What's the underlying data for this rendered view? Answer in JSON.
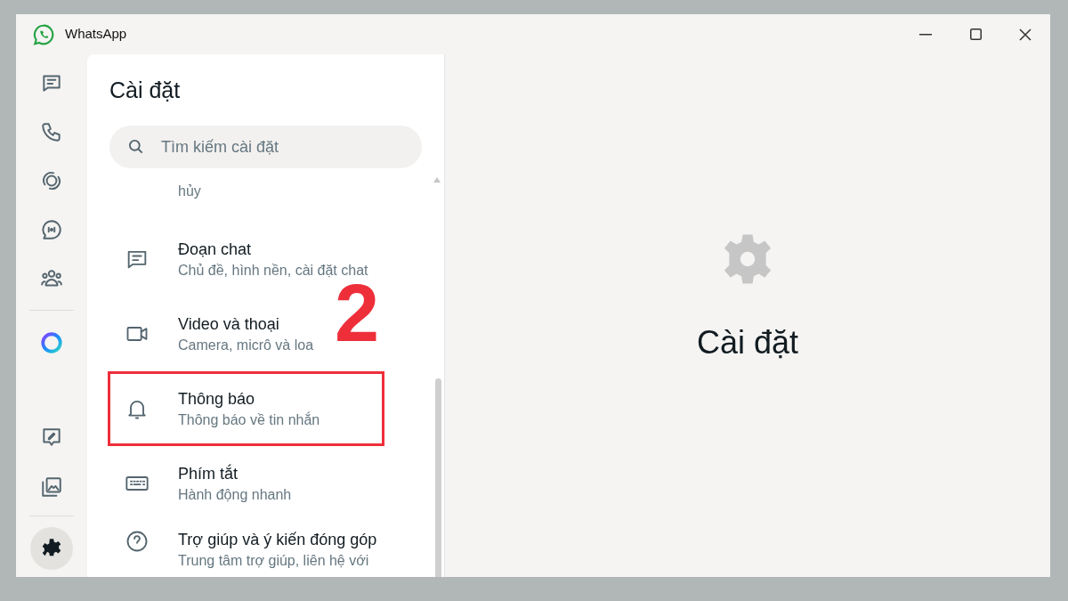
{
  "window": {
    "title": "WhatsApp"
  },
  "nav": {
    "top": [
      {
        "kind": "chats",
        "selected": false
      },
      {
        "kind": "calls",
        "selected": false
      },
      {
        "kind": "status",
        "selected": false
      },
      {
        "kind": "channels",
        "selected": false
      },
      {
        "kind": "communities",
        "selected": false
      }
    ],
    "ai": {
      "kind": "ai"
    },
    "bottom": [
      {
        "kind": "starred",
        "selected": false
      },
      {
        "kind": "media",
        "selected": false
      },
      {
        "kind": "settings",
        "selected": true
      }
    ]
  },
  "settings": {
    "title": "Cài đặt",
    "search": {
      "placeholder": "Tìm kiếm cài đặt"
    },
    "items": [
      {
        "kind": "partial",
        "subtitle": "hủy"
      },
      {
        "kind": "chats",
        "title": "Đoạn chat",
        "subtitle": "Chủ đề, hình nền, cài đặt chat"
      },
      {
        "kind": "video",
        "title": "Video và thoại",
        "subtitle": "Camera, micrô và loa"
      },
      {
        "kind": "notifications",
        "title": "Thông báo",
        "subtitle": "Thông báo về tin nhắn",
        "highlighted": true
      },
      {
        "kind": "shortcuts",
        "title": "Phím tắt",
        "subtitle": "Hành động nhanh"
      },
      {
        "kind": "help",
        "title": "Trợ giúp và ý kiến đóng góp",
        "subtitle": "Trung tâm trợ giúp, liên hệ với"
      }
    ]
  },
  "annotation": {
    "step": "2"
  },
  "detail": {
    "title": "Cài đặt"
  }
}
